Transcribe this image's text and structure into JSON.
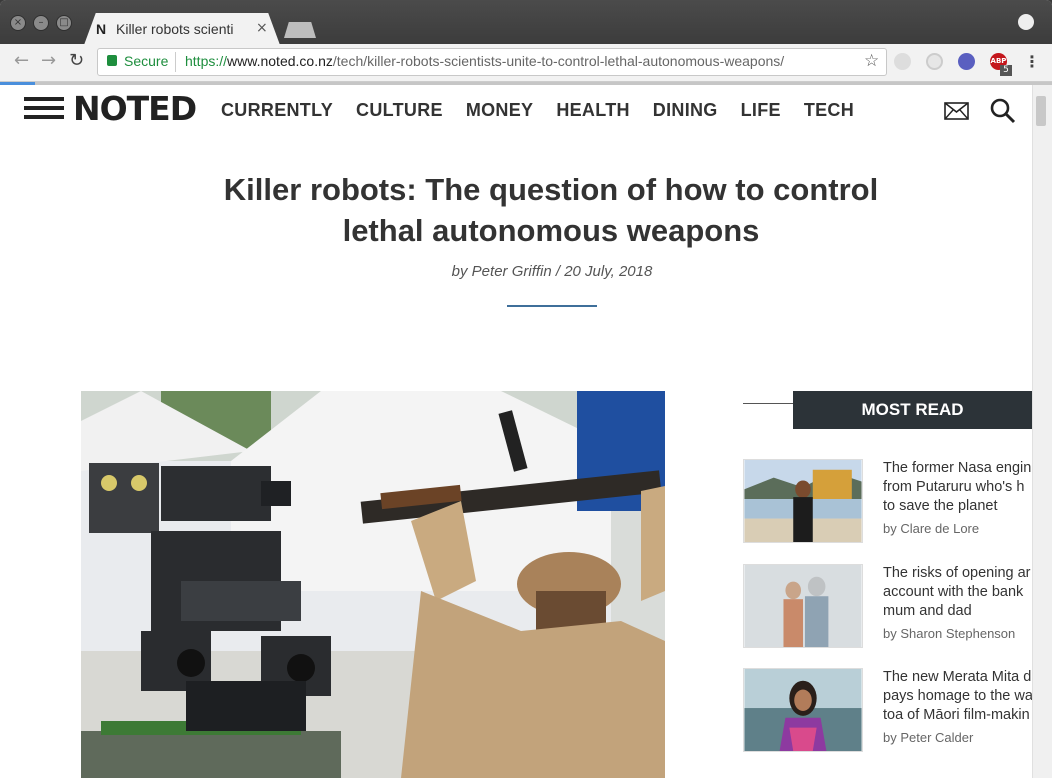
{
  "browser": {
    "tab_favicon": "N",
    "tab_title": "Killer robots scienti",
    "tab_close": "×",
    "secure_label": "Secure",
    "url_scheme": "https://",
    "url_host": "www.noted.co.nz",
    "url_path": "/tech/killer-robots-scientists-unite-to-control-lethal-autonomous-weapons/",
    "back": "←",
    "forward": "→",
    "reload": "↻",
    "star": "☆",
    "menu": "⋮",
    "ext_badge": "5",
    "ext_abp": "ABP"
  },
  "site": {
    "logo": "NOTED",
    "nav": [
      "CURRENTLY",
      "CULTURE",
      "MONEY",
      "HEALTH",
      "DINING",
      "LIFE",
      "TECH"
    ]
  },
  "article": {
    "headline_line1": "Killer robots: The question of how to control",
    "headline_line2": "lethal autonomous weapons",
    "byline": "by Peter Griffin / 20 July, 2018"
  },
  "most_read": {
    "heading": "MOST READ",
    "items": [
      {
        "title": "The former Nasa engin\nfrom Putaruru who's h\nto save the planet",
        "author": "by Clare de Lore"
      },
      {
        "title": "The risks of opening ar\naccount with the bank\nmum and dad",
        "author": "by Sharon Stephenson"
      },
      {
        "title": "The new Merata Mita d\npays homage to the wa\ntoa of Māori film-makin",
        "author": "by Peter Calder"
      }
    ]
  },
  "colors": {
    "accent_blue": "#3f6f9a",
    "header_dark": "#2c3338",
    "secure_green": "#1e8e3e"
  }
}
